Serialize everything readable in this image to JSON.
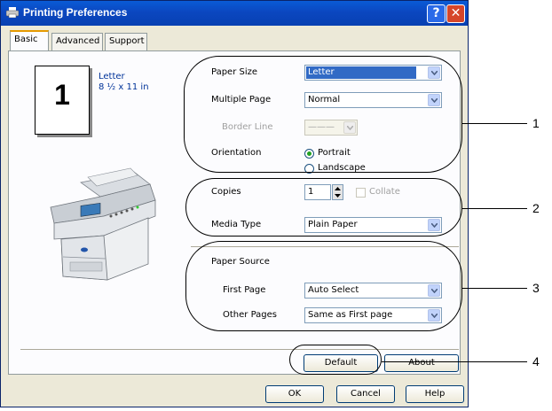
{
  "window": {
    "title": "Printing Preferences",
    "help_btn": "?",
    "close_btn": "✕"
  },
  "tabs": [
    {
      "label": "Basic",
      "active": true
    },
    {
      "label": "Advanced",
      "active": false
    },
    {
      "label": "Support",
      "active": false
    }
  ],
  "preview": {
    "number": "1",
    "paper_name": "Letter",
    "paper_dims": "8 ½ x 11 in"
  },
  "group1": {
    "paper_size": {
      "label": "Paper Size",
      "value": "Letter"
    },
    "multiple_page": {
      "label": "Multiple Page",
      "value": "Normal"
    },
    "border_line": {
      "label": "Border Line",
      "value": "———"
    },
    "orientation": {
      "label": "Orientation",
      "options": [
        "Portrait",
        "Landscape"
      ],
      "selected": "Portrait"
    }
  },
  "group2": {
    "copies": {
      "label": "Copies",
      "value": "1"
    },
    "collate": {
      "label": "Collate",
      "checked": false
    },
    "media_type": {
      "label": "Media Type",
      "value": "Plain Paper"
    }
  },
  "group3": {
    "paper_source_title": "Paper Source",
    "first_page": {
      "label": "First Page",
      "value": "Auto Select"
    },
    "other_pages": {
      "label": "Other Pages",
      "value": "Same as First page"
    }
  },
  "buttons": {
    "default": "Default",
    "about": "About",
    "ok": "OK",
    "cancel": "Cancel",
    "help": "Help"
  },
  "callouts": [
    "1",
    "2",
    "3",
    "4"
  ],
  "colors": {
    "titlebar": "#0b47c0",
    "tab_highlight": "#e69a00",
    "selection": "#316ac5",
    "link_text": "#003399"
  }
}
